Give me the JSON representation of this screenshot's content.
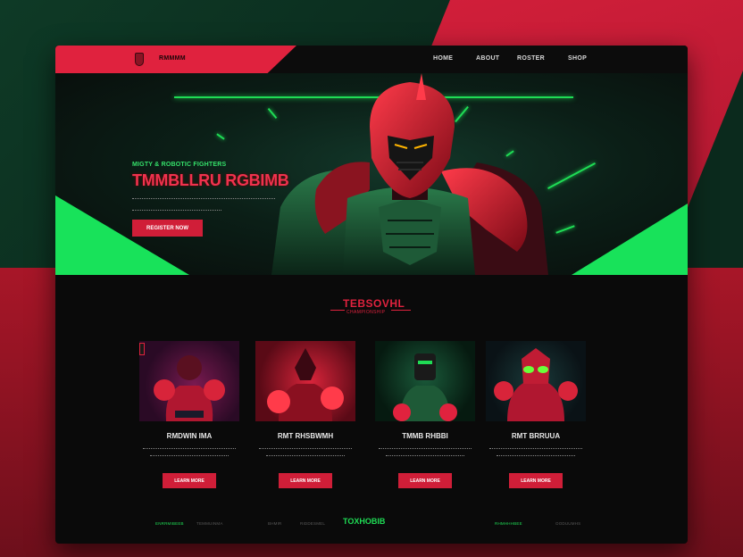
{
  "brand": {
    "name": "RMMMM"
  },
  "nav": {
    "items": [
      "HOME",
      "ABOUT",
      "ROSTER",
      "SHOP"
    ]
  },
  "hero": {
    "eyebrow": "MIGTY & ROBOTIC FIGHTERS",
    "title": "TMMBLLRU RGBIMB",
    "cta": "REGISTER NOW"
  },
  "section": {
    "title": "TEBSOVHL",
    "subtitle": "CHAMPIONSHIP"
  },
  "cards": [
    {
      "name": "RMDWIN IMA",
      "button": "LEARN MORE",
      "badge": ""
    },
    {
      "name": "RMT RHSBWMH",
      "button": "LEARN MORE",
      "badge": ""
    },
    {
      "name": "TMMB RHBBI",
      "button": "LEARN MORE",
      "badge": ""
    },
    {
      "name": "RMT BRRUUA",
      "button": "LEARN MORE",
      "badge": ""
    }
  ],
  "footer": {
    "links": [
      "ENRRMIBEEB",
      "TEMMUINMA",
      "BHMIR",
      "RIDDESMEL",
      "RHMHHHBEE",
      "OODUUMHS"
    ],
    "logo": "TOXHOBIB"
  },
  "colors": {
    "accent_red": "#e0223e",
    "accent_green": "#1fdc55",
    "panel": "#0a0a0a"
  }
}
